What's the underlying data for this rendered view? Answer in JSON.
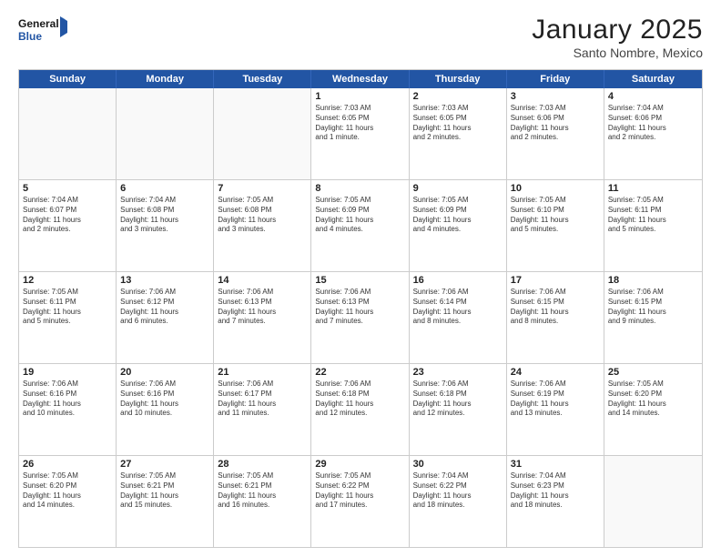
{
  "header": {
    "logo_line1": "General",
    "logo_line2": "Blue",
    "title": "January 2025",
    "subtitle": "Santo Nombre, Mexico"
  },
  "days_of_week": [
    "Sunday",
    "Monday",
    "Tuesday",
    "Wednesday",
    "Thursday",
    "Friday",
    "Saturday"
  ],
  "weeks": [
    [
      {
        "day": "",
        "empty": true,
        "lines": []
      },
      {
        "day": "",
        "empty": true,
        "lines": []
      },
      {
        "day": "",
        "empty": true,
        "lines": []
      },
      {
        "day": "1",
        "empty": false,
        "lines": [
          "Sunrise: 7:03 AM",
          "Sunset: 6:05 PM",
          "Daylight: 11 hours",
          "and 1 minute."
        ]
      },
      {
        "day": "2",
        "empty": false,
        "lines": [
          "Sunrise: 7:03 AM",
          "Sunset: 6:05 PM",
          "Daylight: 11 hours",
          "and 2 minutes."
        ]
      },
      {
        "day": "3",
        "empty": false,
        "lines": [
          "Sunrise: 7:03 AM",
          "Sunset: 6:06 PM",
          "Daylight: 11 hours",
          "and 2 minutes."
        ]
      },
      {
        "day": "4",
        "empty": false,
        "lines": [
          "Sunrise: 7:04 AM",
          "Sunset: 6:06 PM",
          "Daylight: 11 hours",
          "and 2 minutes."
        ]
      }
    ],
    [
      {
        "day": "5",
        "empty": false,
        "lines": [
          "Sunrise: 7:04 AM",
          "Sunset: 6:07 PM",
          "Daylight: 11 hours",
          "and 2 minutes."
        ]
      },
      {
        "day": "6",
        "empty": false,
        "lines": [
          "Sunrise: 7:04 AM",
          "Sunset: 6:08 PM",
          "Daylight: 11 hours",
          "and 3 minutes."
        ]
      },
      {
        "day": "7",
        "empty": false,
        "lines": [
          "Sunrise: 7:05 AM",
          "Sunset: 6:08 PM",
          "Daylight: 11 hours",
          "and 3 minutes."
        ]
      },
      {
        "day": "8",
        "empty": false,
        "lines": [
          "Sunrise: 7:05 AM",
          "Sunset: 6:09 PM",
          "Daylight: 11 hours",
          "and 4 minutes."
        ]
      },
      {
        "day": "9",
        "empty": false,
        "lines": [
          "Sunrise: 7:05 AM",
          "Sunset: 6:09 PM",
          "Daylight: 11 hours",
          "and 4 minutes."
        ]
      },
      {
        "day": "10",
        "empty": false,
        "lines": [
          "Sunrise: 7:05 AM",
          "Sunset: 6:10 PM",
          "Daylight: 11 hours",
          "and 5 minutes."
        ]
      },
      {
        "day": "11",
        "empty": false,
        "lines": [
          "Sunrise: 7:05 AM",
          "Sunset: 6:11 PM",
          "Daylight: 11 hours",
          "and 5 minutes."
        ]
      }
    ],
    [
      {
        "day": "12",
        "empty": false,
        "lines": [
          "Sunrise: 7:05 AM",
          "Sunset: 6:11 PM",
          "Daylight: 11 hours",
          "and 5 minutes."
        ]
      },
      {
        "day": "13",
        "empty": false,
        "lines": [
          "Sunrise: 7:06 AM",
          "Sunset: 6:12 PM",
          "Daylight: 11 hours",
          "and 6 minutes."
        ]
      },
      {
        "day": "14",
        "empty": false,
        "lines": [
          "Sunrise: 7:06 AM",
          "Sunset: 6:13 PM",
          "Daylight: 11 hours",
          "and 7 minutes."
        ]
      },
      {
        "day": "15",
        "empty": false,
        "lines": [
          "Sunrise: 7:06 AM",
          "Sunset: 6:13 PM",
          "Daylight: 11 hours",
          "and 7 minutes."
        ]
      },
      {
        "day": "16",
        "empty": false,
        "lines": [
          "Sunrise: 7:06 AM",
          "Sunset: 6:14 PM",
          "Daylight: 11 hours",
          "and 8 minutes."
        ]
      },
      {
        "day": "17",
        "empty": false,
        "lines": [
          "Sunrise: 7:06 AM",
          "Sunset: 6:15 PM",
          "Daylight: 11 hours",
          "and 8 minutes."
        ]
      },
      {
        "day": "18",
        "empty": false,
        "lines": [
          "Sunrise: 7:06 AM",
          "Sunset: 6:15 PM",
          "Daylight: 11 hours",
          "and 9 minutes."
        ]
      }
    ],
    [
      {
        "day": "19",
        "empty": false,
        "lines": [
          "Sunrise: 7:06 AM",
          "Sunset: 6:16 PM",
          "Daylight: 11 hours",
          "and 10 minutes."
        ]
      },
      {
        "day": "20",
        "empty": false,
        "lines": [
          "Sunrise: 7:06 AM",
          "Sunset: 6:16 PM",
          "Daylight: 11 hours",
          "and 10 minutes."
        ]
      },
      {
        "day": "21",
        "empty": false,
        "lines": [
          "Sunrise: 7:06 AM",
          "Sunset: 6:17 PM",
          "Daylight: 11 hours",
          "and 11 minutes."
        ]
      },
      {
        "day": "22",
        "empty": false,
        "lines": [
          "Sunrise: 7:06 AM",
          "Sunset: 6:18 PM",
          "Daylight: 11 hours",
          "and 12 minutes."
        ]
      },
      {
        "day": "23",
        "empty": false,
        "lines": [
          "Sunrise: 7:06 AM",
          "Sunset: 6:18 PM",
          "Daylight: 11 hours",
          "and 12 minutes."
        ]
      },
      {
        "day": "24",
        "empty": false,
        "lines": [
          "Sunrise: 7:06 AM",
          "Sunset: 6:19 PM",
          "Daylight: 11 hours",
          "and 13 minutes."
        ]
      },
      {
        "day": "25",
        "empty": false,
        "lines": [
          "Sunrise: 7:05 AM",
          "Sunset: 6:20 PM",
          "Daylight: 11 hours",
          "and 14 minutes."
        ]
      }
    ],
    [
      {
        "day": "26",
        "empty": false,
        "lines": [
          "Sunrise: 7:05 AM",
          "Sunset: 6:20 PM",
          "Daylight: 11 hours",
          "and 14 minutes."
        ]
      },
      {
        "day": "27",
        "empty": false,
        "lines": [
          "Sunrise: 7:05 AM",
          "Sunset: 6:21 PM",
          "Daylight: 11 hours",
          "and 15 minutes."
        ]
      },
      {
        "day": "28",
        "empty": false,
        "lines": [
          "Sunrise: 7:05 AM",
          "Sunset: 6:21 PM",
          "Daylight: 11 hours",
          "and 16 minutes."
        ]
      },
      {
        "day": "29",
        "empty": false,
        "lines": [
          "Sunrise: 7:05 AM",
          "Sunset: 6:22 PM",
          "Daylight: 11 hours",
          "and 17 minutes."
        ]
      },
      {
        "day": "30",
        "empty": false,
        "lines": [
          "Sunrise: 7:04 AM",
          "Sunset: 6:22 PM",
          "Daylight: 11 hours",
          "and 18 minutes."
        ]
      },
      {
        "day": "31",
        "empty": false,
        "lines": [
          "Sunrise: 7:04 AM",
          "Sunset: 6:23 PM",
          "Daylight: 11 hours",
          "and 18 minutes."
        ]
      },
      {
        "day": "",
        "empty": true,
        "lines": []
      }
    ]
  ]
}
